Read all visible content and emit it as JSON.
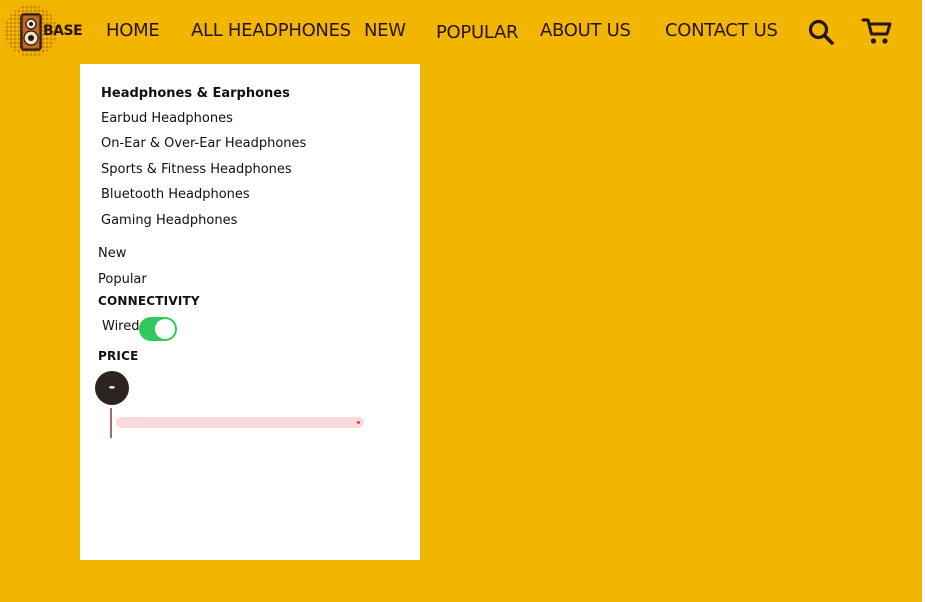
{
  "brand": {
    "logo_text": "BASE"
  },
  "nav": {
    "items": [
      {
        "label": "HOME"
      },
      {
        "label": "ALL HEADPHONES"
      },
      {
        "label": "NEW"
      },
      {
        "label": "POPULAR"
      },
      {
        "label": "ABOUT US"
      },
      {
        "label": "CONTACT US"
      }
    ],
    "icons": {
      "search": "search-icon",
      "cart": "cart-icon"
    }
  },
  "menu": {
    "category_heading": "Headphones & Earphones",
    "categories": [
      {
        "label": "Earbud Headphones"
      },
      {
        "label": "On-Ear & Over-Ear Headphones"
      },
      {
        "label": "Sports & Fitness Headphones"
      },
      {
        "label": "Bluetooth Headphones"
      },
      {
        "label": "Gaming Headphones"
      }
    ],
    "links": [
      {
        "label": "New"
      },
      {
        "label": "Popular"
      }
    ],
    "connectivity": {
      "heading": "CONNECTIVITY",
      "toggle_label": "Wired",
      "toggle_on": true
    },
    "price": {
      "heading": "PRICE",
      "knob_label": "-"
    }
  },
  "colors": {
    "page_background": "#f2b500",
    "panel_background": "#ffffff",
    "text": "#2a1410",
    "toggle_on": "#34c759",
    "price_knob": "#2b2222",
    "price_track": "#ffd9dc"
  }
}
